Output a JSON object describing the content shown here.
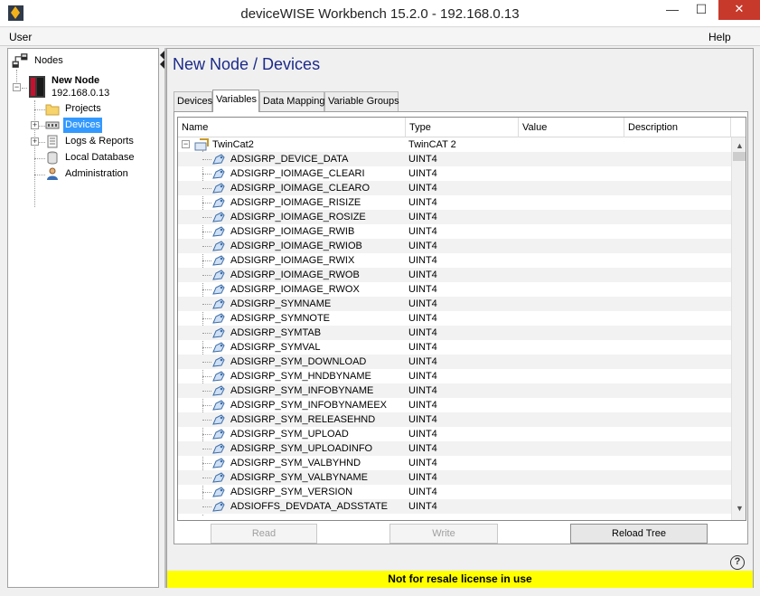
{
  "window": {
    "title": "deviceWISE Workbench 15.2.0  -  192.168.0.13",
    "min_glyph": "—",
    "max_glyph": "☐",
    "close_glyph": "✕"
  },
  "menu": {
    "user": "User",
    "help": "Help"
  },
  "sidebar": {
    "nodes_label": "Nodes",
    "node_name": "New Node",
    "node_ip": "192.168.0.13",
    "items": [
      {
        "label": "Projects",
        "icon": "folder-icon"
      },
      {
        "label": "Devices",
        "icon": "devices-icon",
        "selected": true
      },
      {
        "label": "Logs & Reports",
        "icon": "logs-icon"
      },
      {
        "label": "Local Database",
        "icon": "database-icon"
      },
      {
        "label": "Administration",
        "icon": "admin-user-icon"
      }
    ]
  },
  "main": {
    "title": "New Node / Devices",
    "tabs": [
      "Devices",
      "Variables",
      "Data Mapping",
      "Variable Groups"
    ],
    "active_tab": "Variables"
  },
  "grid": {
    "columns": [
      "Name",
      "Type",
      "Value",
      "Description"
    ],
    "root": {
      "name": "TwinCat2",
      "type": "TwinCAT 2"
    },
    "rows": [
      {
        "name": "ADSIGRP_DEVICE_DATA",
        "type": "UINT4"
      },
      {
        "name": "ADSIGRP_IOIMAGE_CLEARI",
        "type": "UINT4"
      },
      {
        "name": "ADSIGRP_IOIMAGE_CLEARO",
        "type": "UINT4"
      },
      {
        "name": "ADSIGRP_IOIMAGE_RISIZE",
        "type": "UINT4"
      },
      {
        "name": "ADSIGRP_IOIMAGE_ROSIZE",
        "type": "UINT4"
      },
      {
        "name": "ADSIGRP_IOIMAGE_RWIB",
        "type": "UINT4"
      },
      {
        "name": "ADSIGRP_IOIMAGE_RWIOB",
        "type": "UINT4"
      },
      {
        "name": "ADSIGRP_IOIMAGE_RWIX",
        "type": "UINT4"
      },
      {
        "name": "ADSIGRP_IOIMAGE_RWOB",
        "type": "UINT4"
      },
      {
        "name": "ADSIGRP_IOIMAGE_RWOX",
        "type": "UINT4"
      },
      {
        "name": "ADSIGRP_SYMNAME",
        "type": "UINT4"
      },
      {
        "name": "ADSIGRP_SYMNOTE",
        "type": "UINT4"
      },
      {
        "name": "ADSIGRP_SYMTAB",
        "type": "UINT4"
      },
      {
        "name": "ADSIGRP_SYMVAL",
        "type": "UINT4"
      },
      {
        "name": "ADSIGRP_SYM_DOWNLOAD",
        "type": "UINT4"
      },
      {
        "name": "ADSIGRP_SYM_HNDBYNAME",
        "type": "UINT4"
      },
      {
        "name": "ADSIGRP_SYM_INFOBYNAME",
        "type": "UINT4"
      },
      {
        "name": "ADSIGRP_SYM_INFOBYNAMEEX",
        "type": "UINT4"
      },
      {
        "name": "ADSIGRP_SYM_RELEASEHND",
        "type": "UINT4"
      },
      {
        "name": "ADSIGRP_SYM_UPLOAD",
        "type": "UINT4"
      },
      {
        "name": "ADSIGRP_SYM_UPLOADINFO",
        "type": "UINT4"
      },
      {
        "name": "ADSIGRP_SYM_VALBYHND",
        "type": "UINT4"
      },
      {
        "name": "ADSIGRP_SYM_VALBYNAME",
        "type": "UINT4"
      },
      {
        "name": "ADSIGRP_SYM_VERSION",
        "type": "UINT4"
      },
      {
        "name": "ADSIOFFS_DEVDATA_ADSSTATE",
        "type": "UINT4"
      }
    ]
  },
  "buttons": {
    "read": "Read",
    "write": "Write",
    "reload": "Reload Tree"
  },
  "help_glyph": "?",
  "license_text": "Not for resale license in use",
  "colors": {
    "title_blue": "#1c2a8a",
    "selection": "#3399ff",
    "license_yellow": "#ffff00",
    "close_red": "#c7392b"
  }
}
